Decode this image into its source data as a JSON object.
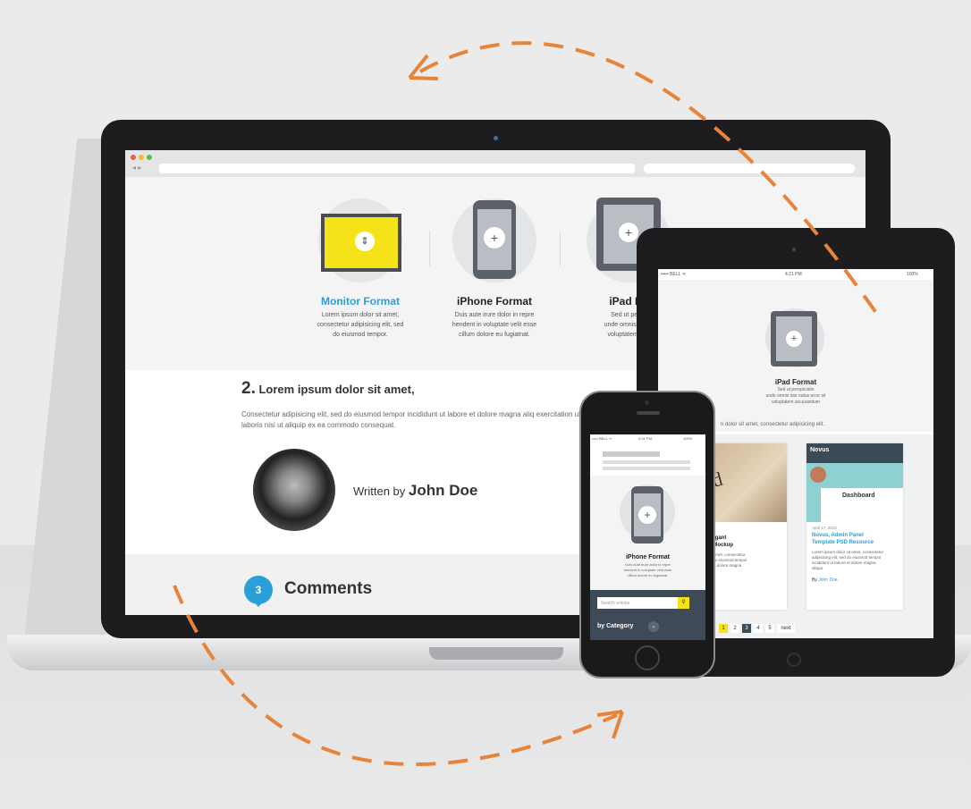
{
  "laptop": {
    "features": [
      {
        "title": "Monitor Format",
        "desc": [
          "Lorem ipsum dolor sit amet,",
          "consectetur adipisicing elit, sed",
          "do eiusmod tempor."
        ]
      },
      {
        "title": "iPhone Format",
        "desc": [
          "Duis aute irure dolor in repre",
          "hendent in voluptate velit esse",
          "cillum dolore eu fugiatnat."
        ]
      },
      {
        "title": "iPad Fo",
        "desc": [
          "Sed ut persp",
          "unde omnis iste n",
          "voluptatem acc"
        ]
      }
    ],
    "section_number": "2.",
    "section_title": "Lorem ipsum dolor sit amet,",
    "paragraph": "Consectetur adipisicing elit, sed do eiusmod tempor incididunt ut labore et dolore magna aliq exercitation ullamco laboris nisi ut aliquip ex ea commodo consequat.",
    "written_by": "Written by",
    "author": "John Doe",
    "comments_count": "3",
    "comments_label": "Comments",
    "colors": {
      "accent": "#2a9fd8",
      "monitor_yellow": "#f5e31a",
      "arrow": "#e8843a"
    }
  },
  "tablet": {
    "status_left": "••••• BELL ᯤ",
    "status_center": "4:21 PM",
    "status_right": "100%",
    "feature_title": "iPad Format",
    "feature_desc": [
      "Sed ut perspiciatis",
      "unde omnis iste natus error sit",
      "voluptatem accusantium"
    ],
    "line": "n dolor sit amet, consectetur adipisicing elit.",
    "card1": {
      "title": [
        "ard, Elegant",
        "s card Mockup"
      ],
      "text": [
        "r dolor sit amet, consectetur",
        "t elit, sed do eiusmod tempor",
        "ut labore et dolore magna"
      ]
    },
    "card2": {
      "date": "April 17, 2013",
      "title": [
        "Novus, Admin Panel",
        "Template PSD Resource"
      ],
      "text": [
        "Lorem ipsum dolor sit amet, consectetur",
        "adipisicing elit, sed do eiusmod tempor",
        "incididunt ut labore et dolore magna",
        "aliqua."
      ],
      "by": "By",
      "author": "John Doe"
    },
    "pager": [
      "1",
      "2",
      "3",
      "4",
      "5"
    ],
    "next": "next"
  },
  "phone": {
    "status_left": "••••• BELL ᯤ",
    "status_center": "4:21 PM",
    "status_right": "100%",
    "feature_title": "iPhone Format",
    "feature_desc": [
      "Duis aute irure dolor in repre",
      "hendent in voluptate velit esse",
      "cillum dolore eu fugiatnat."
    ],
    "search_placeholder": "Search entries",
    "category_label": "by Category"
  }
}
